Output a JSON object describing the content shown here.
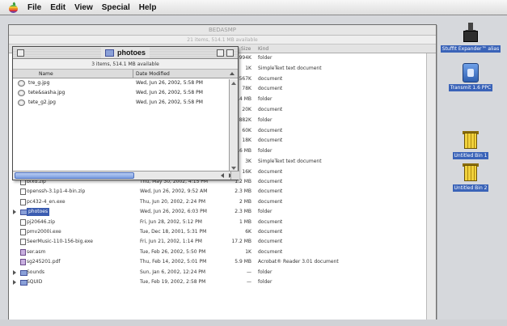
{
  "menubar": {
    "items": [
      "File",
      "Edit",
      "View",
      "Special",
      "Help"
    ]
  },
  "desktop": {
    "icons": [
      {
        "label": "StuffIt Expander™ alias",
        "icon": "stuffit-icon"
      },
      {
        "label": "Transmit 1.6 PPC",
        "icon": "transmit-icon"
      },
      {
        "label": "Untitled Bin 1",
        "icon": "bin-icon"
      },
      {
        "label": "Untitled Bin 2",
        "icon": "bin-icon"
      }
    ]
  },
  "back_window": {
    "title": "BEDASMP",
    "info": "21 items, 514.1 MB available",
    "col_size": "Size",
    "col_kind": "Kind",
    "rows_top": [
      {
        "size": "994K",
        "kind": "folder"
      },
      {
        "size": "1K",
        "kind": "SimpleText text document"
      },
      {
        "size": "567K",
        "kind": "document"
      },
      {
        "size": "78K",
        "kind": "document"
      },
      {
        "size": "1.4 MB",
        "kind": "folder"
      },
      {
        "size": "20K",
        "kind": "document"
      },
      {
        "size": "882K",
        "kind": "folder"
      },
      {
        "size": "60K",
        "kind": "document"
      },
      {
        "size": "18K",
        "kind": "document"
      },
      {
        "size": "45.6 MB",
        "kind": "folder"
      },
      {
        "size": "3K",
        "kind": "SimpleText text document"
      },
      {
        "size": "16K",
        "kind": "document"
      }
    ],
    "rows": [
      {
        "name": "bfxd.zip",
        "date": "Thu, May 30, 2002, 4:15 PM",
        "size": "1.2 MB",
        "kind": "document",
        "icon": "doc"
      },
      {
        "name": "openssh-3.1p1-4-bin.zip",
        "date": "Wed, Jun 26, 2002, 9:52 AM",
        "size": "2.3 MB",
        "kind": "document",
        "icon": "doc"
      },
      {
        "name": "pc432-4_en.exe",
        "date": "Thu, Jun 20, 2002, 2:24 PM",
        "size": "2 MB",
        "kind": "document",
        "icon": "doc"
      },
      {
        "name": "photoes",
        "date": "Wed, Jun 26, 2002, 6:03 PM",
        "size": "2.3 MB",
        "kind": "folder",
        "icon": "folder",
        "selected": true
      },
      {
        "name": "pj20646.zip",
        "date": "Fri, Jun 28, 2002, 5:12 PM",
        "size": "1 MB",
        "kind": "document",
        "icon": "doc"
      },
      {
        "name": "pmv2000i.exe",
        "date": "Tue, Dec 18, 2001, 5:31 PM",
        "size": "6K",
        "kind": "document",
        "icon": "doc"
      },
      {
        "name": "SeerMusic-110-156-big.exe",
        "date": "Fri, Jun 21, 2002, 1:14 PM",
        "size": "17.2 MB",
        "kind": "document",
        "icon": "doc"
      },
      {
        "name": "ser.asm",
        "date": "Tue, Feb 26, 2002, 5:50 PM",
        "size": "1K",
        "kind": "document",
        "icon": "app"
      },
      {
        "name": "sg245201.pdf",
        "date": "Thu, Feb 14, 2002, 5:01 PM",
        "size": "5.9 MB",
        "kind": "Acrobat® Reader 3.01 document",
        "icon": "app"
      },
      {
        "name": "Sounds",
        "date": "Sun, Jan 6, 2002, 12:24 PM",
        "size": "—",
        "kind": "folder",
        "icon": "folder"
      },
      {
        "name": "SQUID",
        "date": "Tue, Feb 19, 2002, 2:58 PM",
        "size": "—",
        "kind": "folder",
        "icon": "folder"
      }
    ]
  },
  "front_window": {
    "title": "photoes",
    "info": "3 items, 514.1 MB available",
    "col_name": "Name",
    "col_date": "Date Modified",
    "files": [
      {
        "name": "tre_g.jpg",
        "date": "Wed, Jun 26, 2002, 5:58 PM"
      },
      {
        "name": "tete&sasha.jpg",
        "date": "Wed, Jun 26, 2002, 5:58 PM"
      },
      {
        "name": "tete_g2.jpg",
        "date": "Wed, Jun 26, 2002, 5:58 PM"
      }
    ]
  }
}
